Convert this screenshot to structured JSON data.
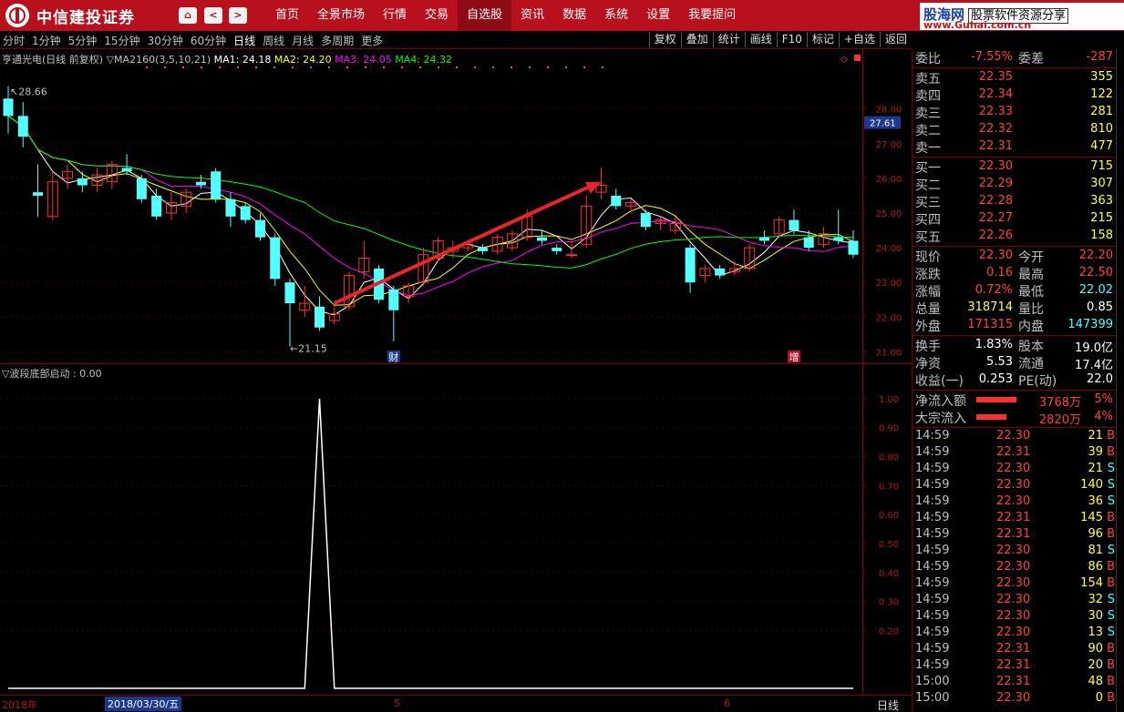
{
  "app": {
    "brand": "中信建投证券",
    "nav_buttons": [
      "⌂",
      "<",
      ">"
    ],
    "menu": [
      "首页",
      "全景市场",
      "行情",
      "交易",
      "自选股",
      "资讯",
      "数据",
      "系统",
      "设置",
      "我要提问"
    ],
    "menu_active_index": 4,
    "watermark_title": "股海网",
    "watermark_slogan": "股票软件资源分享",
    "watermark_url": "www.Guhai.com.cn"
  },
  "toolbar": {
    "periods": [
      "分时",
      "1分钟",
      "5分钟",
      "15分钟",
      "30分钟",
      "60分钟",
      "日线",
      "周线",
      "月线",
      "多周期",
      "更多"
    ],
    "active_period_index": 6,
    "right_buttons": [
      "复权",
      "叠加",
      "统计",
      "画线",
      "F10",
      "标记",
      "+自选",
      "返回"
    ]
  },
  "stock": {
    "title": "亨通光电(日线 前复权)",
    "ma_params": "▽MA2160(3,5,10,21)",
    "ma1": "MA1: 24.18",
    "ma2": "MA2: 24.20",
    "ma3": "MA3: 24.05",
    "ma4": "MA4: 24.32",
    "high_label": "28.66",
    "low_label": "21.15",
    "price_tag": "27.61",
    "event_markers": [
      "财",
      "增"
    ],
    "colors": {
      "up": "#ff3232",
      "down": "#54ffff",
      "ma1": "#ffffff",
      "ma2": "#ffff00",
      "ma3": "#ff00ff",
      "ma4": "#00ff00",
      "arrow": "#e8262a"
    }
  },
  "indicator": {
    "title": "▽波段底部启动 : 0.00"
  },
  "chart_data": [
    {
      "type": "candlestick",
      "title": "亨通光电(日线 前复权)",
      "ylim": [
        20.8,
        29.2
      ],
      "y_ticks": [
        "21.00",
        "22.00",
        "23.00",
        "24.00",
        "25.00",
        "26.00",
        "27.00",
        "28.00"
      ],
      "candles": [
        {
          "o": 28.3,
          "h": 28.66,
          "l": 27.3,
          "c": 27.8
        },
        {
          "o": 27.8,
          "h": 28.2,
          "l": 26.9,
          "c": 27.2
        },
        {
          "o": 25.6,
          "h": 26.4,
          "l": 24.9,
          "c": 25.5
        },
        {
          "o": 24.9,
          "h": 26.2,
          "l": 24.8,
          "c": 25.9
        },
        {
          "o": 26.0,
          "h": 26.4,
          "l": 25.7,
          "c": 26.2
        },
        {
          "o": 26.0,
          "h": 26.2,
          "l": 25.6,
          "c": 25.8
        },
        {
          "o": 25.8,
          "h": 26.3,
          "l": 25.6,
          "c": 26.1
        },
        {
          "o": 25.9,
          "h": 26.5,
          "l": 25.7,
          "c": 26.4
        },
        {
          "o": 26.3,
          "h": 26.7,
          "l": 26.1,
          "c": 26.2
        },
        {
          "o": 26.0,
          "h": 26.1,
          "l": 25.3,
          "c": 25.4
        },
        {
          "o": 25.5,
          "h": 25.7,
          "l": 24.8,
          "c": 24.9
        },
        {
          "o": 25.0,
          "h": 25.6,
          "l": 24.8,
          "c": 25.3
        },
        {
          "o": 25.2,
          "h": 25.7,
          "l": 25.0,
          "c": 25.6
        },
        {
          "o": 25.9,
          "h": 26.1,
          "l": 25.7,
          "c": 25.8
        },
        {
          "o": 26.2,
          "h": 26.3,
          "l": 25.3,
          "c": 25.4
        },
        {
          "o": 25.4,
          "h": 25.6,
          "l": 24.6,
          "c": 24.9
        },
        {
          "o": 25.2,
          "h": 25.3,
          "l": 24.7,
          "c": 24.8
        },
        {
          "o": 24.8,
          "h": 25.0,
          "l": 24.2,
          "c": 24.3
        },
        {
          "o": 24.3,
          "h": 24.4,
          "l": 22.9,
          "c": 23.1
        },
        {
          "o": 23.0,
          "h": 23.1,
          "l": 21.15,
          "c": 22.4
        },
        {
          "o": 22.2,
          "h": 22.9,
          "l": 22.0,
          "c": 22.4
        },
        {
          "o": 22.3,
          "h": 22.6,
          "l": 21.6,
          "c": 21.7
        },
        {
          "o": 21.9,
          "h": 22.4,
          "l": 21.8,
          "c": 22.1
        },
        {
          "o": 22.3,
          "h": 23.3,
          "l": 22.2,
          "c": 23.2
        },
        {
          "o": 23.3,
          "h": 24.2,
          "l": 23.1,
          "c": 23.7
        },
        {
          "o": 23.4,
          "h": 23.5,
          "l": 22.4,
          "c": 22.5
        },
        {
          "o": 22.8,
          "h": 22.9,
          "l": 21.3,
          "c": 22.2
        },
        {
          "o": 22.6,
          "h": 23.0,
          "l": 22.4,
          "c": 22.9
        },
        {
          "o": 23.0,
          "h": 24.0,
          "l": 22.9,
          "c": 23.8
        },
        {
          "o": 23.7,
          "h": 24.3,
          "l": 23.6,
          "c": 24.2
        },
        {
          "o": 23.9,
          "h": 24.2,
          "l": 23.7,
          "c": 24.0
        },
        {
          "o": 24.0,
          "h": 24.2,
          "l": 23.9,
          "c": 24.1
        },
        {
          "o": 24.0,
          "h": 24.1,
          "l": 23.8,
          "c": 23.9
        },
        {
          "o": 23.9,
          "h": 24.4,
          "l": 23.8,
          "c": 24.3
        },
        {
          "o": 24.0,
          "h": 24.5,
          "l": 23.9,
          "c": 24.4
        },
        {
          "o": 24.3,
          "h": 25.1,
          "l": 24.2,
          "c": 24.9
        },
        {
          "o": 24.3,
          "h": 24.5,
          "l": 24.1,
          "c": 24.2
        },
        {
          "o": 24.0,
          "h": 24.1,
          "l": 23.8,
          "c": 23.9
        },
        {
          "o": 23.8,
          "h": 24.2,
          "l": 23.7,
          "c": 23.8
        },
        {
          "o": 24.1,
          "h": 25.5,
          "l": 24.0,
          "c": 25.2
        },
        {
          "o": 25.6,
          "h": 26.3,
          "l": 25.4,
          "c": 25.8
        },
        {
          "o": 25.5,
          "h": 25.7,
          "l": 25.1,
          "c": 25.2
        },
        {
          "o": 25.2,
          "h": 25.4,
          "l": 25.0,
          "c": 25.3
        },
        {
          "o": 25.0,
          "h": 25.1,
          "l": 24.5,
          "c": 24.6
        },
        {
          "o": 24.7,
          "h": 24.9,
          "l": 24.5,
          "c": 24.8
        },
        {
          "o": 24.5,
          "h": 24.9,
          "l": 24.4,
          "c": 24.7
        },
        {
          "o": 24.0,
          "h": 24.1,
          "l": 22.7,
          "c": 23.0
        },
        {
          "o": 23.2,
          "h": 23.5,
          "l": 23.0,
          "c": 23.4
        },
        {
          "o": 23.4,
          "h": 23.5,
          "l": 23.1,
          "c": 23.2
        },
        {
          "o": 23.3,
          "h": 23.6,
          "l": 23.2,
          "c": 23.4
        },
        {
          "o": 23.4,
          "h": 24.1,
          "l": 23.3,
          "c": 24.0
        },
        {
          "o": 24.3,
          "h": 24.5,
          "l": 24.1,
          "c": 24.2
        },
        {
          "o": 24.4,
          "h": 24.9,
          "l": 24.3,
          "c": 24.8
        },
        {
          "o": 24.8,
          "h": 25.1,
          "l": 24.4,
          "c": 24.5
        },
        {
          "o": 24.3,
          "h": 24.5,
          "l": 23.9,
          "c": 24.0
        },
        {
          "o": 24.1,
          "h": 24.6,
          "l": 24.0,
          "c": 24.4
        },
        {
          "o": 24.3,
          "h": 25.1,
          "l": 24.1,
          "c": 24.2
        },
        {
          "o": 24.2,
          "h": 24.5,
          "l": 23.7,
          "c": 23.8
        }
      ]
    },
    {
      "type": "line",
      "title": "▽波段底部启动 : 0.00",
      "ylim": [
        0,
        1.05
      ],
      "y_ticks": [
        "0.20",
        "0.30",
        "0.40",
        "0.50",
        "0.60",
        "0.70",
        "0.80",
        "0.90",
        "1.00"
      ],
      "values": [
        0,
        0,
        0,
        0,
        0,
        0,
        0,
        0,
        0,
        0,
        0,
        0,
        0,
        0,
        0,
        0,
        0,
        0,
        0,
        0,
        0,
        1,
        0,
        0,
        0,
        0,
        0,
        0,
        0,
        0,
        0,
        0,
        0,
        0,
        0,
        0,
        0,
        0,
        0,
        0,
        0,
        0,
        0,
        0,
        0,
        0,
        0,
        0,
        0,
        0,
        0,
        0,
        0,
        0,
        0,
        0,
        0,
        0
      ]
    }
  ],
  "axis_bottom": {
    "year": "2018年",
    "date": "2018/03/30/五",
    "m5": "5",
    "m6": "6",
    "period": "日线"
  },
  "quote": {
    "webi": {
      "label": "委比",
      "value": "-7.55%",
      "label2": "委差",
      "value2": "-287"
    },
    "sells": [
      {
        "label": "卖五",
        "price": "22.35",
        "vol": "355"
      },
      {
        "label": "卖四",
        "price": "22.34",
        "vol": "122"
      },
      {
        "label": "卖三",
        "price": "22.33",
        "vol": "281"
      },
      {
        "label": "卖二",
        "price": "22.32",
        "vol": "810"
      },
      {
        "label": "卖一",
        "price": "22.31",
        "vol": "477"
      }
    ],
    "buys": [
      {
        "label": "买一",
        "price": "22.30",
        "vol": "715"
      },
      {
        "label": "买二",
        "price": "22.29",
        "vol": "307"
      },
      {
        "label": "买三",
        "price": "22.28",
        "vol": "363"
      },
      {
        "label": "买四",
        "price": "22.27",
        "vol": "215"
      },
      {
        "label": "买五",
        "price": "22.26",
        "vol": "158"
      }
    ],
    "stats": [
      {
        "l1": "现价",
        "v1": "22.30",
        "l2": "今开",
        "v2": "22.20"
      },
      {
        "l1": "涨跌",
        "v1": "0.16",
        "l2": "最高",
        "v2": "22.50"
      },
      {
        "l1": "涨幅",
        "v1": "0.72%",
        "l2": "最低",
        "v2": "22.02"
      },
      {
        "l1": "总量",
        "v1": "318714",
        "l2": "量比",
        "v2": "0.85"
      },
      {
        "l1": "外盘",
        "v1": "171315",
        "l2": "内盘",
        "v2": "147399"
      }
    ],
    "finance": [
      {
        "l1": "换手",
        "v1": "1.83%",
        "l2": "股本",
        "v2": "19.0亿"
      },
      {
        "l1": "净资",
        "v1": "5.53",
        "l2": "流通",
        "v2": "17.4亿"
      },
      {
        "l1": "收益(一)",
        "v1": "0.253",
        "l2": "PE(动)",
        "v2": "22.0"
      }
    ],
    "flows": [
      {
        "label": "净流入额",
        "value": "3768万",
        "pct": "5%",
        "bar": 0.44
      },
      {
        "label": "大宗流入",
        "value": "2820万",
        "pct": "4%",
        "bar": 0.33
      }
    ]
  },
  "ticks": [
    {
      "t": "14:59",
      "p": "22.30",
      "q": "21",
      "s": "B"
    },
    {
      "t": "14:59",
      "p": "22.31",
      "q": "39",
      "s": "B"
    },
    {
      "t": "14:59",
      "p": "22.30",
      "q": "21",
      "s": "S"
    },
    {
      "t": "14:59",
      "p": "22.30",
      "q": "140",
      "s": "S"
    },
    {
      "t": "14:59",
      "p": "22.30",
      "q": "36",
      "s": "S"
    },
    {
      "t": "14:59",
      "p": "22.31",
      "q": "145",
      "s": "B"
    },
    {
      "t": "14:59",
      "p": "22.31",
      "q": "96",
      "s": "B"
    },
    {
      "t": "14:59",
      "p": "22.30",
      "q": "81",
      "s": "S"
    },
    {
      "t": "14:59",
      "p": "22.30",
      "q": "86",
      "s": "B"
    },
    {
      "t": "14:59",
      "p": "22.30",
      "q": "154",
      "s": "B"
    },
    {
      "t": "14:59",
      "p": "22.30",
      "q": "32",
      "s": "S"
    },
    {
      "t": "14:59",
      "p": "22.30",
      "q": "30",
      "s": "S"
    },
    {
      "t": "14:59",
      "p": "22.30",
      "q": "13",
      "s": "S"
    },
    {
      "t": "14:59",
      "p": "22.31",
      "q": "90",
      "s": "B"
    },
    {
      "t": "14:59",
      "p": "22.31",
      "q": "20",
      "s": "B"
    },
    {
      "t": "15:00",
      "p": "22.31",
      "q": "48",
      "s": "B"
    },
    {
      "t": "15:00",
      "p": "22.30",
      "q": "0",
      "s": "B"
    }
  ]
}
